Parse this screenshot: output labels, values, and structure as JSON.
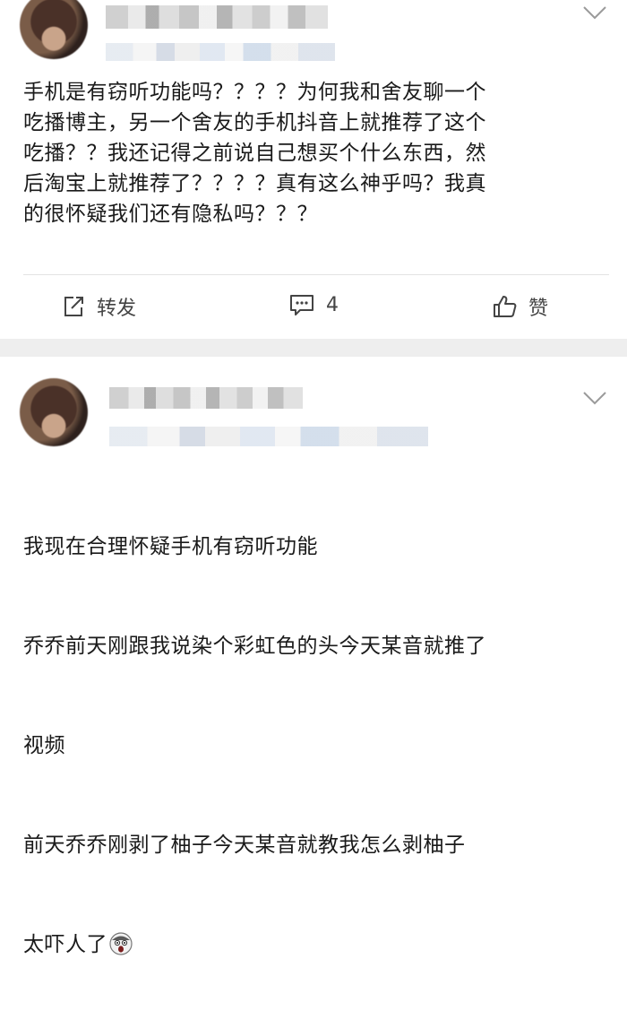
{
  "post1": {
    "avatar_icon": "avatar-blurred",
    "text": "手机是有窃听功能吗？？？？为何我和舍友聊一个\n吃播博主，另一个舍友的手机抖音上就推荐了这个\n吃播？？我还记得之前说自己想买个什么东西，然\n后淘宝上就推荐了？？？？真有这么神乎吗？我真\n的很怀疑我们还有隐私吗？？？",
    "actions": {
      "forward_label": "转发",
      "comment_count": "4",
      "like_label": "赞"
    }
  },
  "post2": {
    "avatar_icon": "avatar-blurred",
    "lines": [
      "我现在合理怀疑手机有窃听功能",
      "乔乔前天刚跟我说染个彩虹色的头今天某音就推了",
      "视频",
      "前天乔乔刚剥了柚子今天某音就教我怎么剥柚子",
      "太吓人了"
    ],
    "trailing_emoji": "scared-face-emoji"
  },
  "colors": {
    "separator": "#eeeeee",
    "text": "#1a1a1a",
    "secondary": "#444444"
  }
}
